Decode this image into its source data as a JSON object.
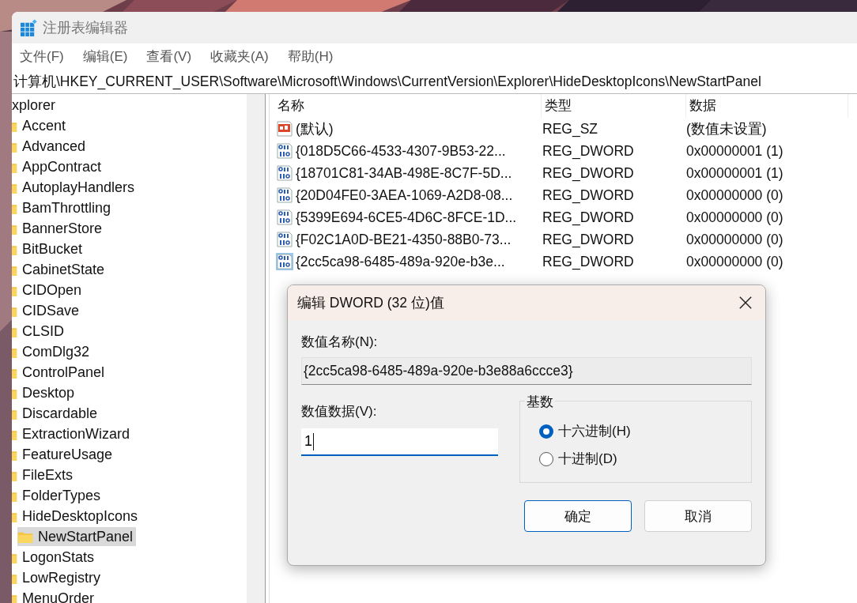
{
  "window": {
    "title": "注册表编辑器"
  },
  "menu": [
    "文件(F)",
    "编辑(E)",
    "查看(V)",
    "收藏夹(A)",
    "帮助(H)"
  ],
  "address": "计算机\\HKEY_CURRENT_USER\\Software\\Microsoft\\Windows\\CurrentVersion\\Explorer\\HideDesktopIcons\\NewStartPanel",
  "tree": {
    "label": "xplorer",
    "selected": false,
    "children": [
      {
        "label": "Accent",
        "selected": false
      },
      {
        "label": "Advanced",
        "selected": false
      },
      {
        "label": "AppContract",
        "selected": false
      },
      {
        "label": "AutoplayHandlers",
        "selected": false
      },
      {
        "label": "BamThrottling",
        "selected": false
      },
      {
        "label": "BannerStore",
        "selected": false
      },
      {
        "label": "BitBucket",
        "selected": false
      },
      {
        "label": "CabinetState",
        "selected": false
      },
      {
        "label": "CIDOpen",
        "selected": false
      },
      {
        "label": "CIDSave",
        "selected": false
      },
      {
        "label": "CLSID",
        "selected": false
      },
      {
        "label": "ComDlg32",
        "selected": false
      },
      {
        "label": "ControlPanel",
        "selected": false
      },
      {
        "label": "Desktop",
        "selected": false
      },
      {
        "label": "Discardable",
        "selected": false
      },
      {
        "label": "ExtractionWizard",
        "selected": false
      },
      {
        "label": "FeatureUsage",
        "selected": false
      },
      {
        "label": "FileExts",
        "selected": false
      },
      {
        "label": "FolderTypes",
        "selected": false
      },
      {
        "label": "HideDesktopIcons",
        "selected": false,
        "children": [
          {
            "label": "NewStartPanel",
            "selected": true
          }
        ]
      },
      {
        "label": "LogonStats",
        "selected": false
      },
      {
        "label": "LowRegistry",
        "selected": false
      },
      {
        "label": "MenuOrder",
        "selected": false
      }
    ]
  },
  "table": {
    "columns": [
      "名称",
      "类型",
      "数据"
    ],
    "rows": [
      {
        "kind": "string",
        "name": "(默认)",
        "type": "REG_SZ",
        "data": "(数值未设置)",
        "selected": false
      },
      {
        "kind": "dword",
        "name": "{018D5C66-4533-4307-9B53-22...",
        "type": "REG_DWORD",
        "data": "0x00000001 (1)",
        "selected": false
      },
      {
        "kind": "dword",
        "name": "{18701C81-34AB-498E-8C7F-5D...",
        "type": "REG_DWORD",
        "data": "0x00000001 (1)",
        "selected": false
      },
      {
        "kind": "dword",
        "name": "{20D04FE0-3AEA-1069-A2D8-08...",
        "type": "REG_DWORD",
        "data": "0x00000000 (0)",
        "selected": false
      },
      {
        "kind": "dword",
        "name": "{5399E694-6CE5-4D6C-8FCE-1D...",
        "type": "REG_DWORD",
        "data": "0x00000000 (0)",
        "selected": false
      },
      {
        "kind": "dword",
        "name": "{F02C1A0D-BE21-4350-88B0-73...",
        "type": "REG_DWORD",
        "data": "0x00000000 (0)",
        "selected": false
      },
      {
        "kind": "dword",
        "name": "{2cc5ca98-6485-489a-920e-b3e...",
        "type": "REG_DWORD",
        "data": "0x00000000 (0)",
        "selected": true
      }
    ]
  },
  "dialog": {
    "title": "编辑 DWORD (32 位)值",
    "name_label": "数值名称(N):",
    "name_value": "{2cc5ca98-6485-489a-920e-b3e88a6ccce3}",
    "data_label": "数值数据(V):",
    "data_value": "1",
    "base_label": "基数",
    "bases": [
      {
        "label": "十六进制(H)",
        "selected": true
      },
      {
        "label": "十进制(D)",
        "selected": false
      }
    ],
    "buttons": [
      {
        "label": "确定",
        "default": true
      },
      {
        "label": "取消",
        "default": false
      }
    ]
  }
}
